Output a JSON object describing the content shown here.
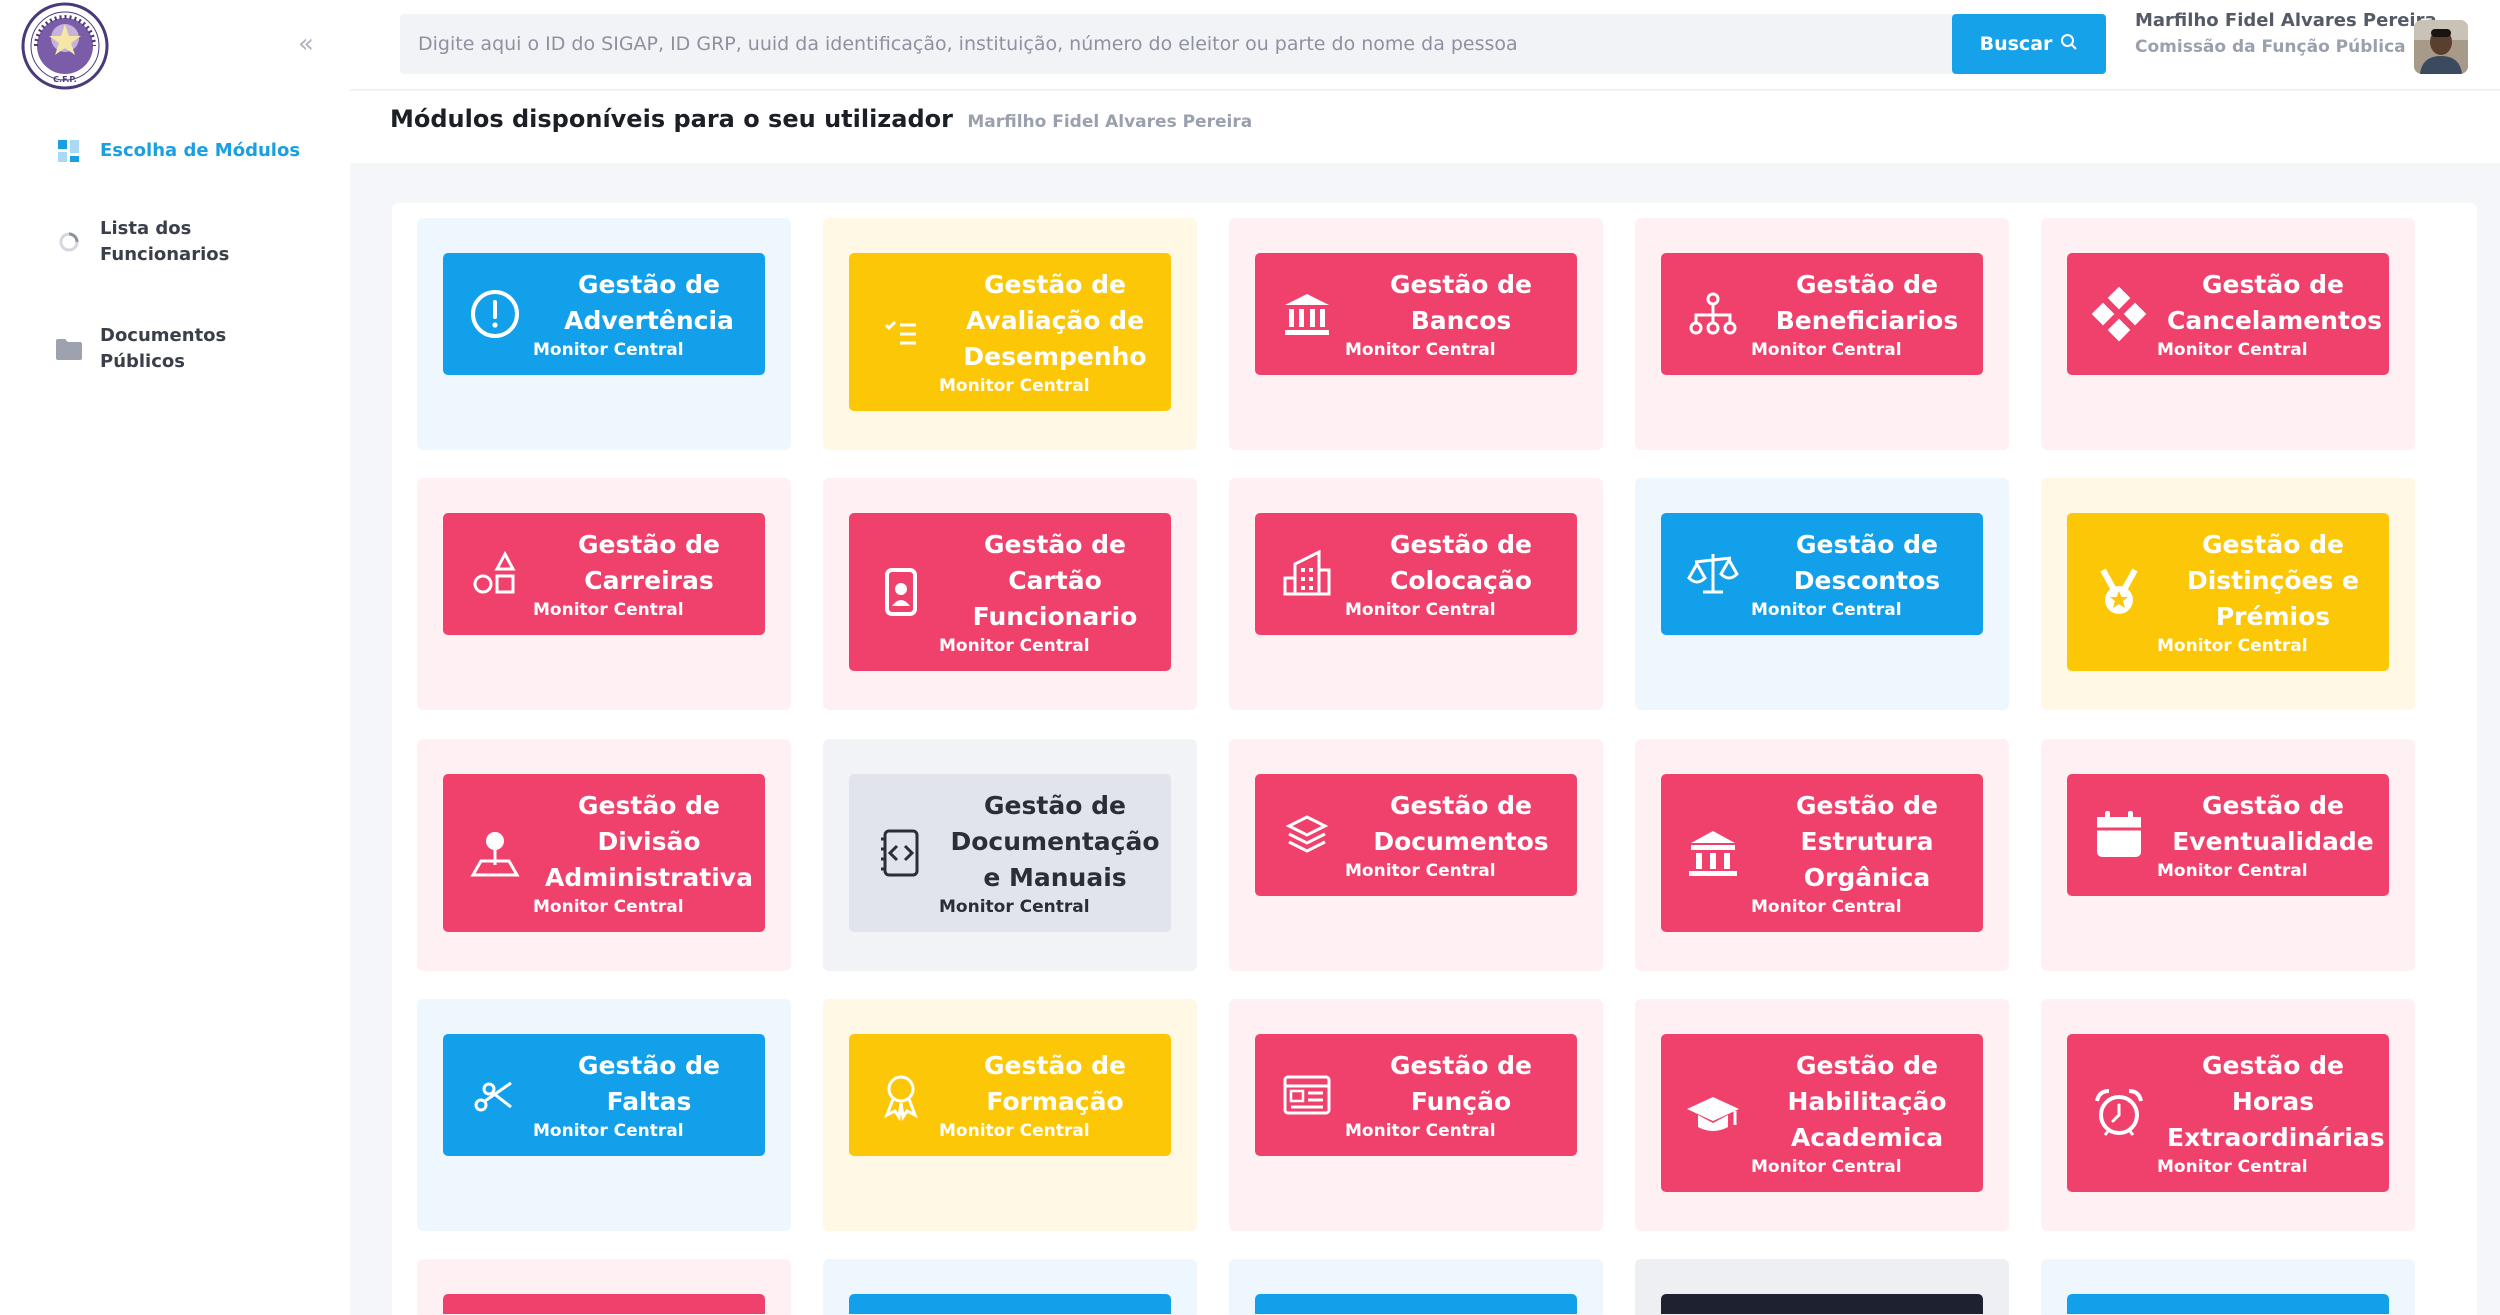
{
  "colors": {
    "blue": "#13a0ea",
    "yellow": "#fcc707",
    "pink": "#f0416d",
    "grey": "#e1e4ec",
    "navy": "#1e2130",
    "tile_blue": "#eef7fd",
    "tile_yellow": "#fef8e4",
    "tile_pink": "#fef0f3",
    "tile_grey": "#f2f3f6",
    "tile_navy": "#eeeff2"
  },
  "sidebar": {
    "collapse_icon": "chevrons-left-icon",
    "items": [
      {
        "label": "Escolha de Módulos",
        "icon": "grid-icon",
        "active": true
      },
      {
        "label": "Lista dos Funcionarios",
        "icon": "loader-icon",
        "active": false
      },
      {
        "label": "Documentos Públicos",
        "icon": "folder-icon",
        "active": false
      }
    ]
  },
  "search": {
    "placeholder": "Digite aqui o ID do SIGAP, ID GRP, uuid da identificação, instituição, número do eleitor ou parte do nome da pessoa",
    "button_label": "Buscar"
  },
  "user": {
    "name": "Marfilho Fidel Alvares Pereira",
    "organization": "Comissão da Função Pública"
  },
  "page": {
    "title": "Módulos disponíveis para o seu utilizador",
    "user_name": "Marfilho Fidel Alvares Pereira"
  },
  "modules": [
    {
      "title": "Gestão de Advertência",
      "subtitle": "Monitor Central",
      "color": "blue",
      "icon": "alert-circle-icon"
    },
    {
      "title": "Gestão de Avaliação de Desempenho",
      "subtitle": "Monitor Central",
      "color": "yellow",
      "icon": "checklist-icon"
    },
    {
      "title": "Gestão de Bancos",
      "subtitle": "Monitor Central",
      "color": "pink",
      "icon": "bank-icon"
    },
    {
      "title": "Gestão de Beneficiarios",
      "subtitle": "Monitor Central",
      "color": "pink",
      "icon": "hierarchy-icon"
    },
    {
      "title": "Gestão de Cancelamentos",
      "subtitle": "Monitor Central",
      "color": "pink",
      "icon": "diamond-grid-icon"
    },
    {
      "title": "Gestão de Carreiras",
      "subtitle": "Monitor Central",
      "color": "pink",
      "icon": "shapes-icon"
    },
    {
      "title": "Gestão de Cartão Funcionario",
      "subtitle": "Monitor Central",
      "color": "pink",
      "icon": "id-badge-icon"
    },
    {
      "title": "Gestão de Colocação",
      "subtitle": "Monitor Central",
      "color": "pink",
      "icon": "buildings-icon"
    },
    {
      "title": "Gestão de Descontos",
      "subtitle": "Monitor Central",
      "color": "blue",
      "icon": "scale-icon"
    },
    {
      "title": "Gestão de Distinções e Prémios",
      "subtitle": "Monitor Central",
      "color": "yellow",
      "icon": "medal-icon"
    },
    {
      "title": "Gestão de Divisão Administrativa",
      "subtitle": "Monitor Central",
      "color": "pink",
      "icon": "map-pin-icon"
    },
    {
      "title": "Gestão de Documentação e Manuais",
      "subtitle": "Monitor Central",
      "color": "grey",
      "icon": "code-file-icon"
    },
    {
      "title": "Gestão de Documentos",
      "subtitle": "Monitor Central",
      "color": "pink",
      "icon": "layers-icon"
    },
    {
      "title": "Gestão de Estrutura Orgânica",
      "subtitle": "Monitor Central",
      "color": "pink",
      "icon": "institution-icon"
    },
    {
      "title": "Gestão de Eventualidade",
      "subtitle": "Monitor Central",
      "color": "pink",
      "icon": "calendar-icon"
    },
    {
      "title": "Gestão de Faltas",
      "subtitle": "Monitor Central",
      "color": "blue",
      "icon": "scissors-icon"
    },
    {
      "title": "Gestão de Formação",
      "subtitle": "Monitor Central",
      "color": "yellow",
      "icon": "award-icon"
    },
    {
      "title": "Gestão de Função",
      "subtitle": "Monitor Central",
      "color": "pink",
      "icon": "id-card-icon"
    },
    {
      "title": "Gestão de Habilitação Academica",
      "subtitle": "Monitor Central",
      "color": "pink",
      "icon": "graduation-cap-icon"
    },
    {
      "title": "Gestão de Horas Extraordinárias",
      "subtitle": "Monitor Central",
      "color": "pink",
      "icon": "alarm-clock-icon"
    }
  ],
  "partial_row": [
    "pink",
    "blue",
    "blue",
    "navy",
    "blue"
  ]
}
